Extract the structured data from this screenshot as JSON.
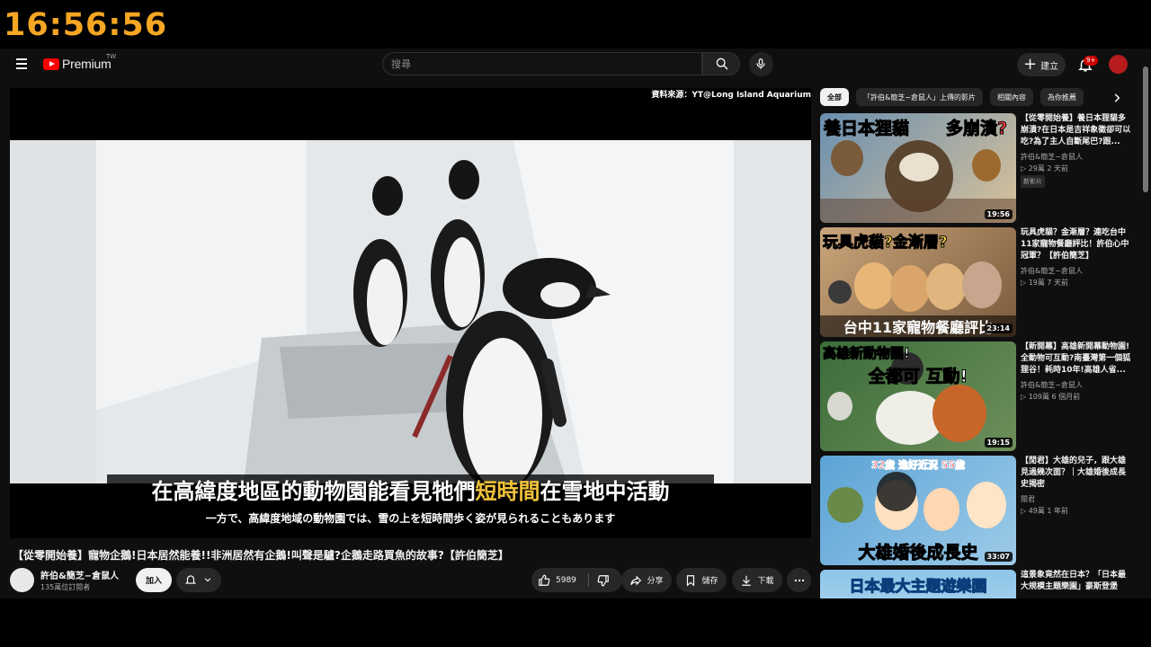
{
  "overlay_clock": "16:56:56",
  "masthead": {
    "logo_text": "Premium",
    "country_code": "TW",
    "search_placeholder": "搜尋",
    "create_label": "建立",
    "notification_badge": "9+"
  },
  "player": {
    "source_credit": "資料來源：YT@Long Island Aquarium",
    "subtitle_zh_before": "在高緯度地區的動物園能看見牠們",
    "subtitle_zh_highlight": "短時間",
    "subtitle_zh_after": "在雪地中活動",
    "subtitle_jp": "一方で、高緯度地域の動物園では、雪の上を短時間歩く姿が見られることもあります"
  },
  "video": {
    "title": "【從零開始養】寵物企鵝!日本居然能養!!非洲居然有企鵝!叫聲是驢?企鵝走路買魚的故事?【許伯簡芝】",
    "channel_name": "許伯&簡芝−倉鼠人",
    "subscribers": "135萬位訂閱者",
    "join_label": "加入",
    "like_count": "5989",
    "share_label": "分享",
    "save_label": "儲存",
    "download_label": "下載"
  },
  "chips": [
    "全部",
    "「許伯&簡芝−倉鼠人」上傳的影片",
    "相關內容",
    "為你推薦"
  ],
  "related": [
    {
      "title": "【從零開始養】養日本狸貓多崩潰?在日本是吉祥象徵卻可以吃?為了主人自斷尾巴?跟...",
      "channel": "許伯&簡芝−倉鼠人",
      "meta": "▷ 29萬 2 天前",
      "badge": "新影片",
      "duration": "19:56",
      "thumb_top": "養日本狸貓",
      "thumb_bottom": "多崩潰?",
      "colors": [
        "#6a8fb0",
        "#d9c29a"
      ]
    },
    {
      "title": "玩具虎貓？金漸層？連吃台中11家寵物餐廳評比！許伯心中冠軍？【許伯簡芝】",
      "channel": "許伯&簡芝−倉鼠人",
      "meta": "▷ 19萬 7 天前",
      "duration": "23:14",
      "thumb_top": "玩具虎貓?金漸層?",
      "thumb_bottom": "台中11家寵物餐廳評比",
      "colors": [
        "#caa57a",
        "#7a5a3c"
      ]
    },
    {
      "title": "【新開幕】高雄新開幕動物園!全動物可互動?南臺灣第一個狐狸谷！耗時10年!高雄人省...",
      "channel": "許伯&簡芝−倉鼠人",
      "meta": "▷ 109萬 6 個月前",
      "duration": "19:15",
      "thumb_top": "高雄新動物園!",
      "thumb_bottom": "全都可 互動!",
      "colors": [
        "#3b6d3a",
        "#e0e0d8"
      ]
    },
    {
      "title": "【閒君】大雄的兒子，跟大雄見過幾次面？｜大雄婚後成長史揭密",
      "channel": "閒君",
      "meta": "▷ 49萬 1 年前",
      "duration": "33:07",
      "thumb_top": "32歲 逸好近況 55歲",
      "thumb_bottom": "大雄婚後成長史",
      "colors": [
        "#5ba3d6",
        "#f2c94c"
      ]
    },
    {
      "title": "這景象竟然在日本？「日本最大規模主題樂園」豪斯登堡",
      "channel": "",
      "meta": "",
      "duration": "",
      "thumb_top": "日本最大主題遊樂園",
      "thumb_bottom": "",
      "colors": [
        "#8ec5e8",
        "#ffffff"
      ]
    }
  ],
  "icons": {
    "menu": "hamburger-icon",
    "search": "search-icon",
    "mic": "microphone-icon",
    "bell": "bell-icon",
    "like": "thumbs-up-icon",
    "dislike": "thumbs-down-icon",
    "share": "share-arrow-icon",
    "save": "bookmark-icon",
    "download": "download-icon",
    "more": "more-horizontal-icon",
    "chevron": "chevron-right-icon"
  }
}
